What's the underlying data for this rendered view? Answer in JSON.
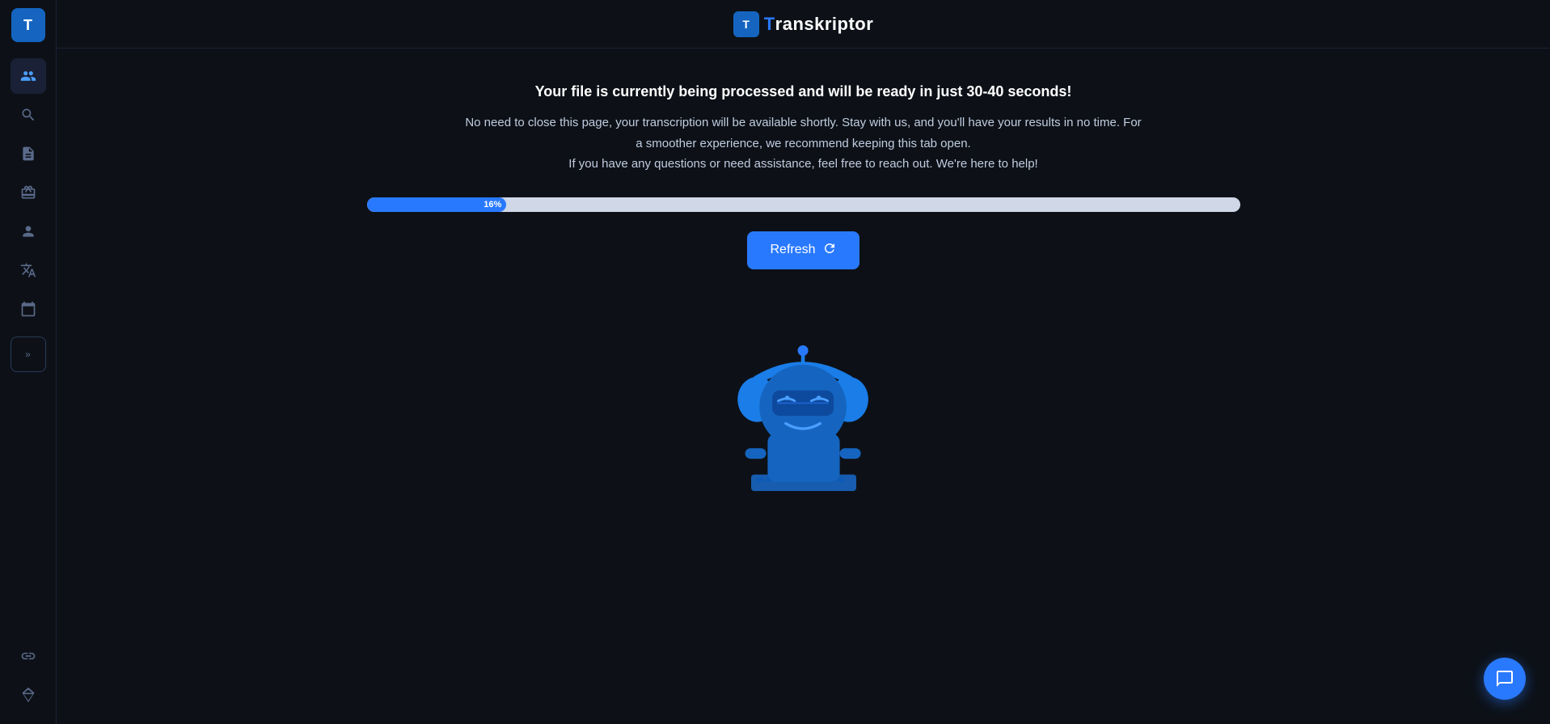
{
  "app": {
    "title": "Transkriptor",
    "logo_letter": "T"
  },
  "sidebar": {
    "items": [
      {
        "id": "team",
        "icon": "👥",
        "label": "Team",
        "active": true
      },
      {
        "id": "search",
        "icon": "🔍",
        "label": "Search",
        "active": false
      },
      {
        "id": "document",
        "icon": "📄",
        "label": "Documents",
        "active": false
      },
      {
        "id": "gift",
        "icon": "🎁",
        "label": "Gift",
        "active": false
      },
      {
        "id": "user",
        "icon": "👤",
        "label": "User",
        "active": false
      },
      {
        "id": "translate",
        "icon": "🔤",
        "label": "Translate",
        "active": false
      },
      {
        "id": "calendar",
        "icon": "📅",
        "label": "Calendar",
        "active": false
      },
      {
        "id": "link",
        "icon": "🔗",
        "label": "Link",
        "active": false
      },
      {
        "id": "gem",
        "icon": "💎",
        "label": "Premium",
        "active": false
      }
    ],
    "expand_label": ">>"
  },
  "processing": {
    "headline": "Your file is currently being processed and will be ready in just 30-40 seconds!",
    "subtext_line1": "No need to close this page, your transcription will be available shortly. Stay with us, and you'll have your results in no time. For",
    "subtext_line2": "a smoother experience, we recommend keeping this tab open.",
    "subtext_line3": "If you have any questions or need assistance, feel free to reach out. We're here to help!",
    "progress_percent": 16,
    "progress_label": "16%",
    "refresh_label": "Refresh"
  },
  "colors": {
    "accent": "#2979ff",
    "bg_dark": "#0d1117",
    "bg_body": "#0a0e1a",
    "sidebar_bg": "#0d1117",
    "progress_bg": "#d0d8e8",
    "text_primary": "#ffffff",
    "text_secondary": "#c0cce0"
  }
}
